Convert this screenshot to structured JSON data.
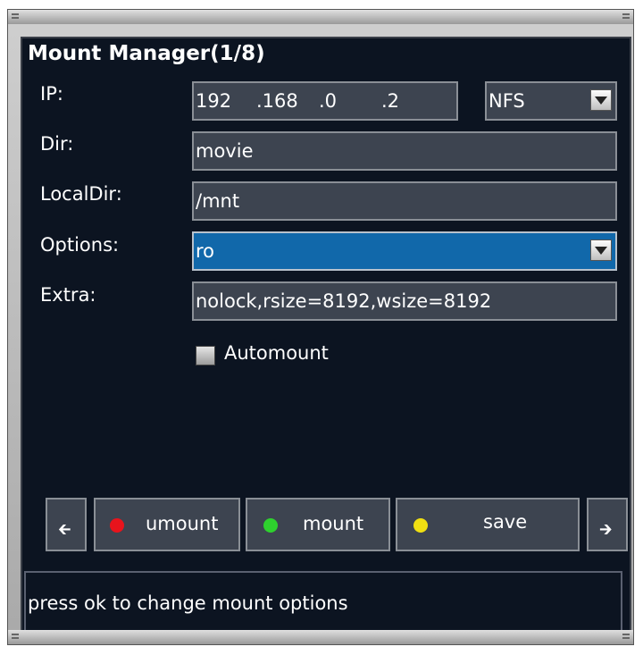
{
  "window": {
    "title": "Mount Manager(1/8)"
  },
  "form": {
    "ip": {
      "label": "IP:",
      "segments": [
        "192",
        ".168",
        ".0",
        ".2"
      ]
    },
    "fs_type": {
      "value": "NFS"
    },
    "dir": {
      "label": "Dir:",
      "value": "movie"
    },
    "localdir": {
      "label": "LocalDir:",
      "value": "/mnt"
    },
    "options": {
      "label": "Options:",
      "value": "ro"
    },
    "extra": {
      "label": "Extra:",
      "value": "nolock,rsize=8192,wsize=8192"
    },
    "automount": {
      "label": "Automount",
      "checked": false
    }
  },
  "buttons": {
    "prev_icon": "left-arrow-icon",
    "umount": {
      "label": "umount",
      "color": "#e8141c"
    },
    "mount": {
      "label": "mount",
      "color": "#2ed12e"
    },
    "save": {
      "label": "save",
      "color": "#f0df12"
    },
    "next_icon": "right-arrow-icon"
  },
  "status": {
    "text": "press ok to change mount options"
  },
  "colors": {
    "panel_bg": "#0c1421",
    "field_bg": "#3d4450",
    "selected_bg": "#1168aa"
  }
}
